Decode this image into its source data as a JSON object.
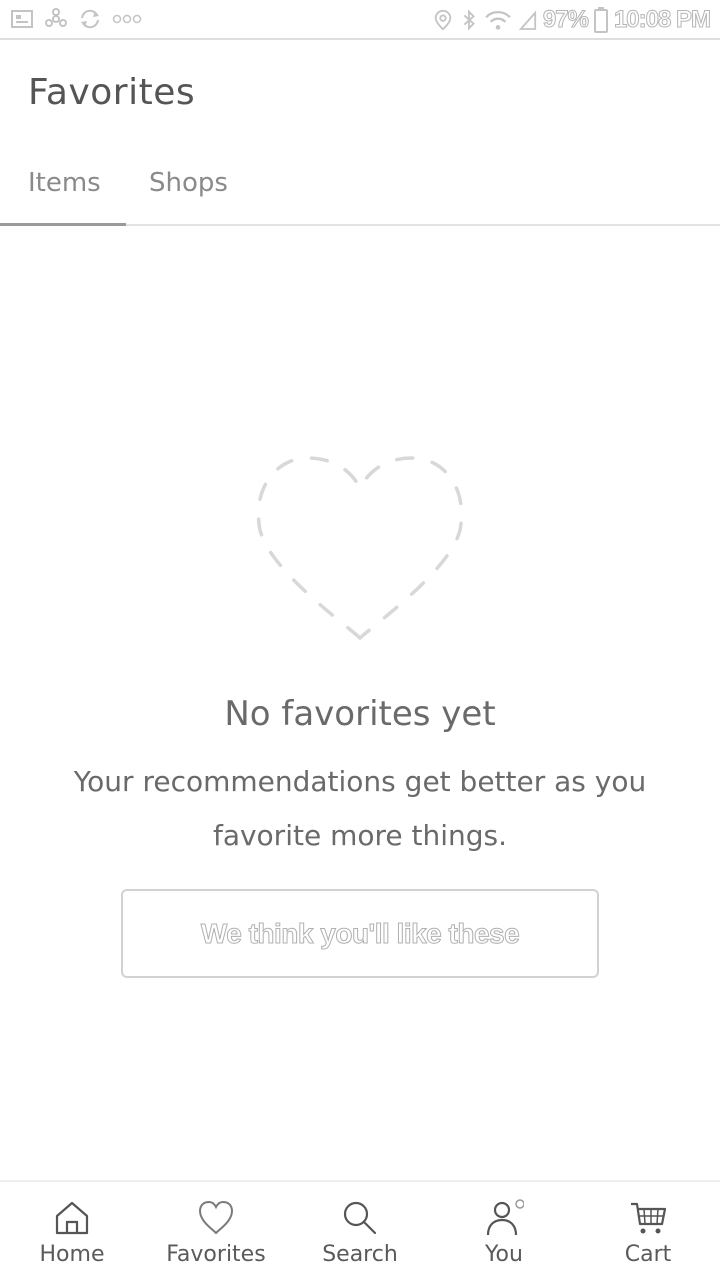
{
  "status_bar": {
    "battery": "97%",
    "time": "10:08 PM",
    "left_icons": [
      "image-icon",
      "fan-icon",
      "sync-icon",
      "more-icon"
    ],
    "right_icons": [
      "location-icon",
      "bluetooth-icon",
      "wifi-icon",
      "signal-icon",
      "battery-icon"
    ]
  },
  "header": {
    "title": "Favorites"
  },
  "tabs": [
    {
      "label": "Items",
      "active": true
    },
    {
      "label": "Shops",
      "active": false
    }
  ],
  "empty_state": {
    "icon": "dashed-heart-icon",
    "title": "No favorites yet",
    "subtitle": "Your recommendations get better as you favorite more things.",
    "button_label": "We think you'll like these"
  },
  "bottom_nav": [
    {
      "label": "Home",
      "icon": "home-icon"
    },
    {
      "label": "Favorites",
      "icon": "heart-icon"
    },
    {
      "label": "Search",
      "icon": "search-icon"
    },
    {
      "label": "You",
      "icon": "person-icon"
    },
    {
      "label": "Cart",
      "icon": "cart-icon"
    }
  ]
}
